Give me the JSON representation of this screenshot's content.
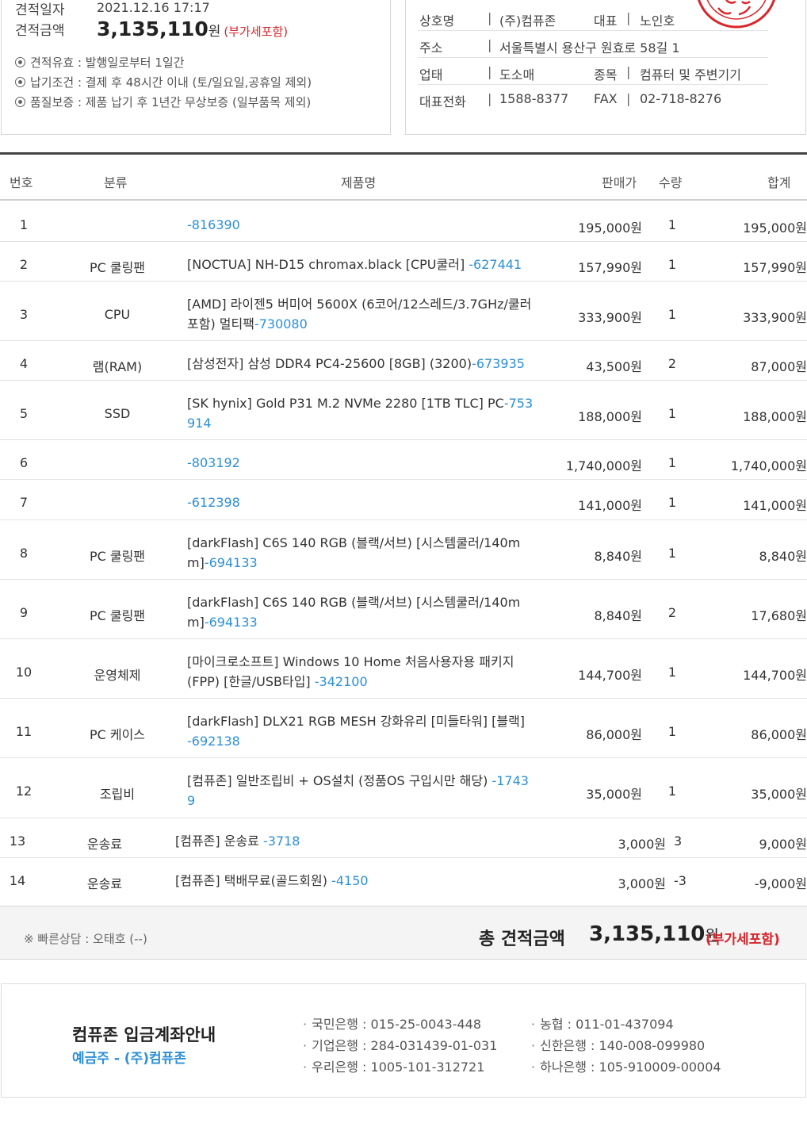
{
  "quote": {
    "date_label": "견적일자",
    "date_value": "2021.12.16 17:17",
    "amount_label": "견적금액",
    "amount_value": "3,135,110",
    "won": "원",
    "vat_note": "(부가세포함)",
    "notes": [
      "견적유효 : 발행일로부터 1일간",
      "납기조건 : 결제 후 48시간 이내 (토/일요일,공휴일 제외)",
      "품질보증 : 제품 납기 후 1년간 무상보증 (일부품목 제외)"
    ]
  },
  "company": {
    "name_label": "상호명",
    "name_value": "(주)컴퓨존",
    "ceo_label": "대표",
    "ceo_value": "노인호",
    "addr_label": "주소",
    "addr_value": "서울특별시 용산구 원효로 58길 1",
    "biz_label": "업태",
    "biz_value": "도소매",
    "type_label": "종목",
    "type_value": "컴퓨터 및 주변기기",
    "tel_label": "대표전화",
    "tel_value": "1588-8377",
    "fax_label": "FAX",
    "fax_value": "02-718-8276",
    "separator": "|",
    "stamp_color": "#d9262b"
  },
  "table": {
    "headers": {
      "num": "번호",
      "category": "분류",
      "name": "제품명",
      "price": "판매가",
      "qty": "수량",
      "total": "합계"
    },
    "rows": [
      {
        "num": "1",
        "category": "",
        "name": "",
        "pid": "-816390",
        "price": "195,000원",
        "qty": "1",
        "total": "195,000원"
      },
      {
        "num": "2",
        "category": "PC 쿨링팬",
        "name": "[NOCTUA] NH-D15 chromax.black [CPU쿨러] ",
        "pid": "-627441",
        "price": "157,990원",
        "qty": "1",
        "total": "157,990원"
      },
      {
        "num": "3",
        "category": "CPU",
        "name": "[AMD] 라이젠5 버미어 5600X (6코어/12스레드/3.7GHz/쿨러포함) 멀티팩",
        "pid": "-730080",
        "price": "333,900원",
        "qty": "1",
        "total": "333,900원"
      },
      {
        "num": "4",
        "category": "램(RAM)",
        "name": "[삼성전자] 삼성 DDR4 PC4-25600 [8GB] (3200)",
        "pid": "-673935",
        "price": "43,500원",
        "qty": "2",
        "total": "87,000원"
      },
      {
        "num": "5",
        "category": "SSD",
        "name": "[SK hynix] Gold P31 M.2 NVMe 2280 [1TB TLC] PC",
        "pid": "-753914",
        "price": "188,000원",
        "qty": "1",
        "total": "188,000원"
      },
      {
        "num": "6",
        "category": "",
        "name": "",
        "pid": "-803192",
        "price": "1,740,000원",
        "qty": "1",
        "total": "1,740,000원"
      },
      {
        "num": "7",
        "category": "",
        "name": "",
        "pid": "-612398",
        "price": "141,000원",
        "qty": "1",
        "total": "141,000원"
      },
      {
        "num": "8",
        "category": "PC 쿨링팬",
        "name": "[darkFlash] C6S 140 RGB (블랙/서브) [시스템쿨러/140mm]",
        "pid": "-694133",
        "price": "8,840원",
        "qty": "1",
        "total": "8,840원"
      },
      {
        "num": "9",
        "category": "PC 쿨링팬",
        "name": "[darkFlash] C6S 140 RGB (블랙/서브) [시스템쿨러/140mm]",
        "pid": "-694133",
        "price": "8,840원",
        "qty": "2",
        "total": "17,680원"
      },
      {
        "num": "10",
        "category": "운영체제",
        "name": "[마이크로소프트] Windows 10 Home 처음사용자용 패키지(FPP) [한글/USB타입] ",
        "pid": "-342100",
        "price": "144,700원",
        "qty": "1",
        "total": "144,700원"
      },
      {
        "num": "11",
        "category": "PC 케이스",
        "name": "[darkFlash] DLX21 RGB MESH 강화유리 [미들타워] [블랙] ",
        "pid": "-692138",
        "price": "86,000원",
        "qty": "1",
        "total": "86,000원"
      },
      {
        "num": "12",
        "category": "조립비",
        "name": "[컴퓨존] 일반조립비 + OS설치 (정품OS 구입시만 해당) ",
        "pid": "-17439",
        "price": "35,000원",
        "qty": "1",
        "total": "35,000원"
      },
      {
        "num": "13",
        "category": "운송료",
        "name": "[컴퓨존] 운송료 ",
        "pid": "-3718",
        "price": "3,000원",
        "qty": "3",
        "total": "9,000원"
      },
      {
        "num": "14",
        "category": "운송료",
        "name": "[컴퓨존] 택배무료(골드회원) ",
        "pid": "-4150",
        "price": "3,000원",
        "qty": "-3",
        "total": "-9,000원"
      }
    ]
  },
  "summary": {
    "consult": "※ 빠른상담 : 오태호 (--)",
    "grand_label": "총 견적금액",
    "grand_amount": "3,135,110",
    "won": "원",
    "vat_note": "(부가세포함)"
  },
  "bank": {
    "title": "컴퓨존 입금계좌안내",
    "holder": "예금주 - (주)컴퓨존",
    "accounts": [
      "국민은행 : 015-25-0043-448",
      "기업은행 : 284-031439-01-031",
      "우리은행 : 1005-101-312721",
      "농협 : 011-01-437094",
      "신한은행 : 140-008-099980",
      "하나은행 : 105-910009-00004"
    ]
  },
  "colors": {
    "accent_blue": "#2b8fd8",
    "accent_red": "#d9262b",
    "rule_dark": "#444444"
  }
}
